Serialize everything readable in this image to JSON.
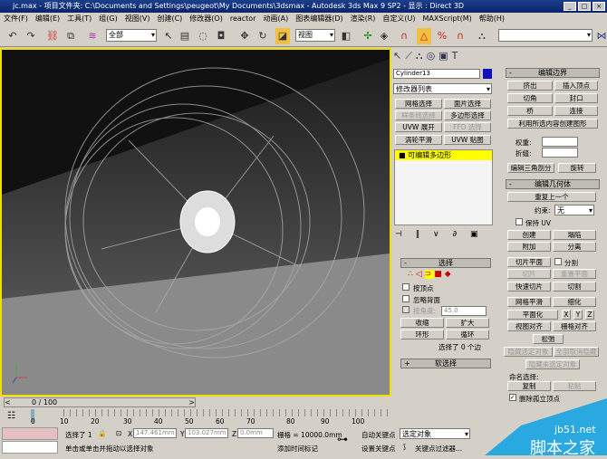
{
  "title": "jc.max    - 项目文件夹: C:\\Documents and Settings\\peugeot\\My Documents\\3dsmax    - Autodesk 3ds Max 9 SP2    - 显示 : Direct 3D",
  "menu": [
    "文件(F)",
    "编辑(E)",
    "工具(T)",
    "组(G)",
    "视图(V)",
    "创建(C)",
    "修改器(O)",
    "reactor",
    "动画(A)",
    "图表编辑器(D)",
    "渲染(R)",
    "自定义(U)",
    "MAXScript(M)",
    "帮助(H)"
  ],
  "toolbar": {
    "selection_filter": "全部",
    "ref_coord": "视图",
    "named_sel": ""
  },
  "panel": {
    "object_name": "Cylinder13",
    "object_color": "#1010c0",
    "modifier_list": "修改器列表",
    "mod_buttons": [
      "网格选择",
      "面片选择",
      "样条线选择",
      "多边形选择",
      "UVW 展开",
      "FFD 选择",
      "涡轮平滑",
      "UVW 贴图"
    ],
    "stack_item": "可编辑多边形",
    "selection": {
      "title": "选择",
      "by_vertex": "按顶点",
      "ignore_backfacing": "忽略背面",
      "by_angle": "按角度:",
      "angle_value": "45.0",
      "shrink": "收缩",
      "grow": "扩大",
      "ring": "环形",
      "loop": "循环",
      "status": "选择了 0 个边"
    },
    "soft_selection": "软选择",
    "edit_borders": {
      "title": "编辑边界",
      "extrude": "挤出",
      "insert_vertex": "插入顶点",
      "chamfer": "切角",
      "cap": "封口",
      "bridge": "桥",
      "connect": "连接",
      "create_shape": "利用所选内容创建图形",
      "weight": "权重:",
      "crease": "折缝:",
      "edit_tri": "编辑三角剖分",
      "turn": "旋转"
    },
    "edit_geometry": {
      "title": "编辑几何体",
      "repeat_last": "重复上一个",
      "constraints": "约束:",
      "constraint_value": "无",
      "preserve_uvs": "保持 UV",
      "create": "创建",
      "collapse": "塌陷",
      "attach": "附加",
      "detach": "分离",
      "slice_plane": "切片平面",
      "split": "分割",
      "slice": "切片",
      "reset_plane": "重置平面",
      "quickslice": "快速切片",
      "cut": "切割",
      "meshsmooth": "网格平滑",
      "tessellate": "细化",
      "make_planar": "平面化",
      "x": "X",
      "y": "Y",
      "z": "Z",
      "view_align": "视图对齐",
      "grid_align": "栅格对齐",
      "relax": "松弛",
      "hide_selected": "隐藏选定对象",
      "unhide_all": "全部取消隐藏",
      "hide_unselected": "隐藏未选定对象",
      "named_sel": "命名选择:",
      "copy": "复制",
      "paste": "粘贴",
      "delete_isolated": "删除孤立顶点"
    }
  },
  "timeline": {
    "frame": "0 / 100",
    "ticks": [
      "0",
      "10",
      "20",
      "30",
      "40",
      "50",
      "60",
      "70",
      "80",
      "90",
      "100"
    ]
  },
  "status": {
    "selected": "选择了 1",
    "x": "147.461mm",
    "y": "103.027mm",
    "z": "0.0mm",
    "grid": "栅格 = 10000.0mm",
    "auto_key": "自动关键点",
    "set_key": "设置关键点",
    "key_mode": "选定对象",
    "key_filters": "关键点过滤器...",
    "prompt": "单击或单击并拖动以选择对象",
    "add_time_tag": "添加时间标记",
    "watermark_site": "jb51.net",
    "watermark_name": "脚本之家"
  }
}
